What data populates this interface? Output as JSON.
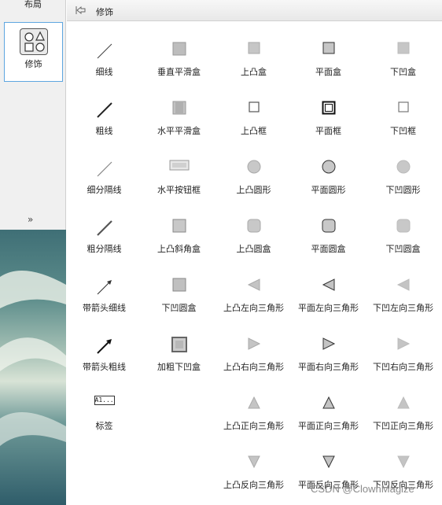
{
  "sidebar": {
    "top_label": "布局",
    "selected_label": "修饰"
  },
  "header": {
    "title": "修饰"
  },
  "items": [
    {
      "label": "细线",
      "icon": "thin-line-icon"
    },
    {
      "label": "垂直平滑盒",
      "icon": "vertical-smooth-box-icon"
    },
    {
      "label": "上凸盒",
      "icon": "raised-box-icon"
    },
    {
      "label": "平面盒",
      "icon": "flat-box-icon"
    },
    {
      "label": "下凹盒",
      "icon": "sunken-box-icon"
    },
    {
      "label": "粗线",
      "icon": "thick-line-icon"
    },
    {
      "label": "水平平滑盒",
      "icon": "horizontal-smooth-box-icon"
    },
    {
      "label": "上凸框",
      "icon": "raised-frame-icon"
    },
    {
      "label": "平面框",
      "icon": "flat-frame-icon"
    },
    {
      "label": "下凹框",
      "icon": "sunken-frame-icon"
    },
    {
      "label": "细分隔线",
      "icon": "thin-separator-icon"
    },
    {
      "label": "水平按钮框",
      "icon": "horizontal-button-frame-icon"
    },
    {
      "label": "上凸圆形",
      "icon": "raised-circle-icon"
    },
    {
      "label": "平面圆形",
      "icon": "flat-circle-icon"
    },
    {
      "label": "下凹圆形",
      "icon": "sunken-circle-icon"
    },
    {
      "label": "粗分隔线",
      "icon": "thick-separator-icon"
    },
    {
      "label": "上凸斜角盒",
      "icon": "raised-bevel-box-icon"
    },
    {
      "label": "上凸圆盒",
      "icon": "raised-round-box-icon"
    },
    {
      "label": "平面圆盒",
      "icon": "flat-round-box-icon"
    },
    {
      "label": "下凹圆盒",
      "icon": "sunken-round-box-icon"
    },
    {
      "label": "带箭头细线",
      "icon": "thin-arrow-icon"
    },
    {
      "label": "下凹圆盒",
      "icon": "sunken-round-box-2-icon"
    },
    {
      "label": "上凸左向三角形",
      "icon": "raised-left-triangle-icon"
    },
    {
      "label": "平面左向三角形",
      "icon": "flat-left-triangle-icon"
    },
    {
      "label": "下凹左向三角形",
      "icon": "sunken-left-triangle-icon"
    },
    {
      "label": "带箭头粗线",
      "icon": "thick-arrow-icon"
    },
    {
      "label": "加粗下凹盒",
      "icon": "bold-sunken-box-icon"
    },
    {
      "label": "上凸右向三角形",
      "icon": "raised-right-triangle-icon"
    },
    {
      "label": "平面右向三角形",
      "icon": "flat-right-triangle-icon"
    },
    {
      "label": "下凹右向三角形",
      "icon": "sunken-right-triangle-icon"
    },
    {
      "label": "标签",
      "icon": "label-icon",
      "icon_text": "A1..."
    },
    {
      "label": "",
      "icon": ""
    },
    {
      "label": "上凸正向三角形",
      "icon": "raised-up-triangle-icon"
    },
    {
      "label": "平面正向三角形",
      "icon": "flat-up-triangle-icon"
    },
    {
      "label": "下凹正向三角形",
      "icon": "sunken-up-triangle-icon"
    },
    {
      "label": "",
      "icon": ""
    },
    {
      "label": "",
      "icon": ""
    },
    {
      "label": "上凸反向三角形",
      "icon": "raised-down-triangle-icon"
    },
    {
      "label": "平面反向三角形",
      "icon": "flat-down-triangle-icon"
    },
    {
      "label": "下凹反向三角形",
      "icon": "sunken-down-triangle-icon"
    }
  ],
  "watermark": "CSDN @ClownMagize"
}
